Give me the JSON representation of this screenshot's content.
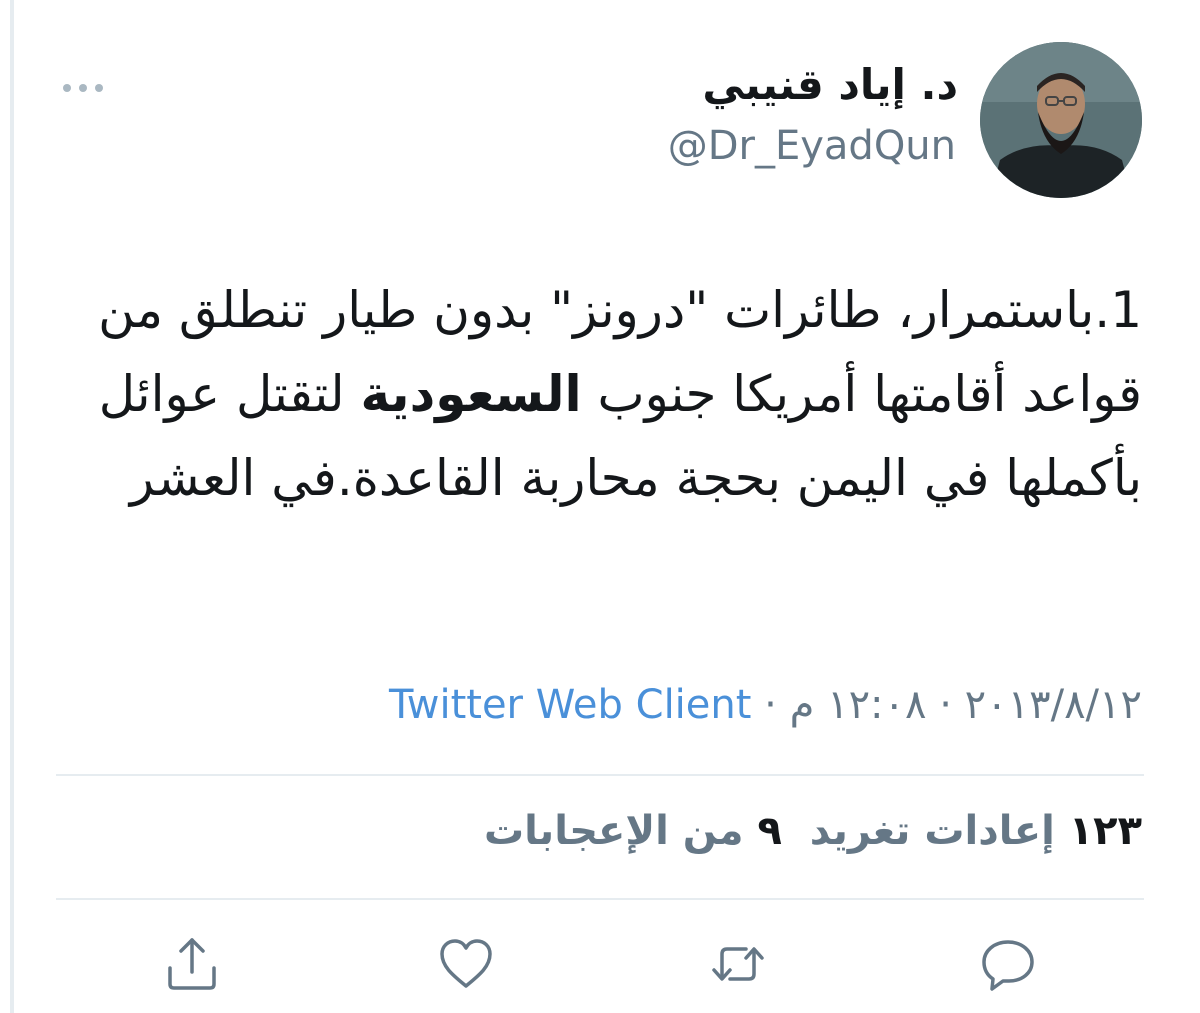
{
  "user": {
    "display_name": "د. إياد قنيبي",
    "handle": "@Dr_EyadQun",
    "avatar_icon": "user-avatar"
  },
  "tweet": {
    "text_before": "1.باستمرار، طائرات \"درونز\" بدون طيار تنطلق من قواعد أقامتها أمريكا جنوب ",
    "text_emphasis": "السعودية",
    "text_after": " لتقتل عوائل بأكملها في اليمن بحجة محاربة القاعدة.في العشر"
  },
  "meta": {
    "date": "٢٠١٣/٨/١٢",
    "separator": "·",
    "time": "١٢:٠٨ م",
    "client": "Twitter Web Client"
  },
  "stats": {
    "retweets_count": "١٢٣",
    "retweets_label": "إعادات تغريد",
    "likes_count": "٩",
    "likes_label": "من الإعجابات"
  },
  "icons": {
    "more": "more-dots-icon",
    "reply": "reply-icon",
    "retweet": "retweet-icon",
    "like": "heart-icon",
    "share": "share-icon"
  },
  "colors": {
    "link": "#4a90d9",
    "secondary_text": "#657786",
    "primary_text": "#14171a",
    "divider": "#e6ecf0",
    "icon": "#657786"
  }
}
